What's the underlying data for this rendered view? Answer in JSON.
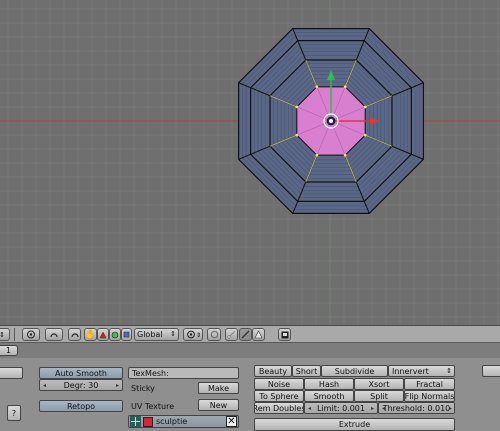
{
  "header": {
    "pivot_select": "Global",
    "window_type_icon": "image-icon"
  },
  "subheader": {
    "frame_field": "1"
  },
  "mesh_panel": {
    "auto_smooth_label": "Auto Smooth",
    "degree_field": "Degr: 30",
    "retopo_label": "Retopo",
    "texmesh_field": "TexMesh:",
    "sticky_label": "Sticky",
    "make_label": "Make",
    "uv_texture_label": "UV Texture",
    "new_label": "New",
    "uv_layer_name": "sculptie",
    "side_button": "?"
  },
  "mesh_tools": {
    "beauty": "Beauty",
    "short": "Short",
    "subdivide": "Subdivide",
    "innervert": "Innervert",
    "noise": "Noise",
    "hash": "Hash",
    "xsort": "Xsort",
    "fractal": "Fractal",
    "to_sphere": "To Sphere",
    "smooth": "Smooth",
    "split": "Split",
    "flip_normals": "Flip Normals",
    "rem_doubles": "Rem Doubles",
    "limit": "Limit: 0.001",
    "threshold": "Threshold: 0.010",
    "extrude": "Extrude"
  },
  "colors": {
    "viewport_bg": "#6f6f6f",
    "grid_line": "#777777",
    "mesh_face": "#5a6786",
    "selected_face": "#d87fd0",
    "x_axis": "#d83a3a",
    "y_axis": "#2fbf4b",
    "wire": "#111111",
    "panel_bg": "#8f8f8f",
    "button_blue": "#9aa9b7"
  }
}
